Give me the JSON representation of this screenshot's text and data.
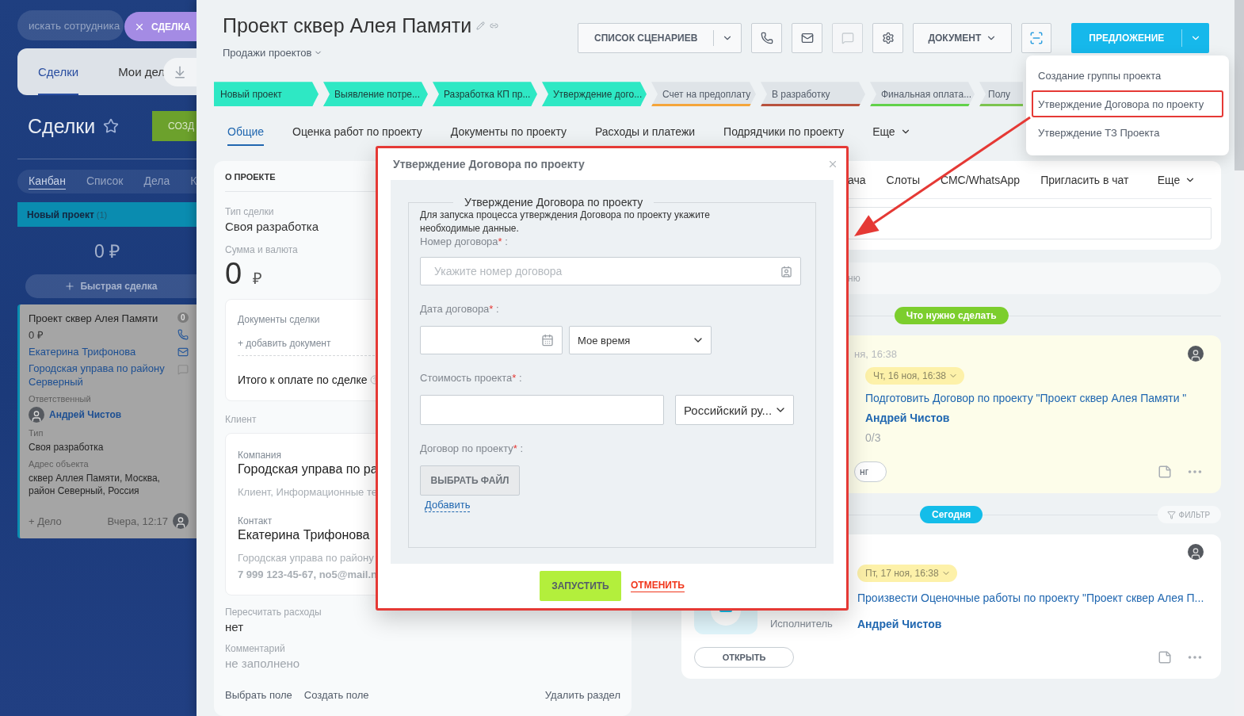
{
  "kanban": {
    "search": {
      "placeholder": "искать сотрудника"
    },
    "deal_chip": "СДЕЛКА",
    "top_tabs": [
      {
        "label": "Сделки",
        "selected": true
      },
      {
        "label": "Мои дел",
        "selected": false
      }
    ],
    "title": "Сделки",
    "create_button": "СОЗД",
    "view_tabs": [
      {
        "label": "Канбан",
        "selected": true
      },
      {
        "label": "Список",
        "selected": false
      },
      {
        "label": "Дела",
        "selected": false
      },
      {
        "label": "К",
        "selected": false
      }
    ],
    "column": {
      "title": "Новый проект",
      "count": "(1)",
      "total": "0 ₽",
      "quick_add": "Быстрая сделка"
    },
    "card": {
      "title": "Проект сквер Алея Памяти",
      "badge": "0",
      "amount": "0 ₽",
      "contact": "Екатерина Трифонова",
      "company": "Городская управа по району Серверный",
      "responsible_label": "Ответственный",
      "responsible": "Андрей Чистов",
      "fields": [
        {
          "label": "Тип",
          "value": "Своя разработка"
        },
        {
          "label": "Адрес объекта",
          "value": "сквер Аллея Памяти, Москва, район Северный, Россия"
        }
      ],
      "add_task": "+ Дело",
      "time": "Вчера, 12:17"
    }
  },
  "deal": {
    "title": "Проект сквер Алея Памяти",
    "pipeline": "Продажи проектов",
    "toolbar": {
      "scenarios": "СПИСОК СЦЕНАРИЕВ",
      "icon_buttons": [
        {
          "kind": "phone",
          "disabled": false
        },
        {
          "kind": "mail",
          "disabled": false
        },
        {
          "kind": "chat",
          "disabled": true
        },
        {
          "kind": "settings",
          "disabled": false
        }
      ],
      "document": "ДОКУМЕНТ",
      "offer": "ПРЕДЛОЖЕНИЕ"
    },
    "stages": [
      {
        "label": "Новый проект",
        "done": true,
        "color": "#2ee8c4"
      },
      {
        "label": "Выявление потре...",
        "done": true,
        "color": "#2ee8c4"
      },
      {
        "label": "Разработка КП пр...",
        "done": true,
        "color": "#2ee8c4"
      },
      {
        "label": "Утверждение дого...",
        "done": true,
        "color": "#2ee8c4"
      },
      {
        "label": "Счет на предоплату",
        "done": false,
        "color": "#f5a53a"
      },
      {
        "label": "В разработку",
        "done": false,
        "color": "#b8523e"
      },
      {
        "label": "Финальная оплата...",
        "done": false,
        "color": "#62d14a"
      },
      {
        "label": "Полу",
        "done": false,
        "color": "#7cc44f"
      }
    ],
    "tabs": [
      {
        "label": "Общие",
        "selected": true
      },
      {
        "label": "Оценка работ по проекту",
        "selected": false
      },
      {
        "label": "Документы по проекту",
        "selected": false
      },
      {
        "label": "Расходы и платежи",
        "selected": false
      },
      {
        "label": "Подрядчики по проекту",
        "selected": false
      }
    ],
    "more_tab": "Еще",
    "about": {
      "heading": "О ПРОЕКТЕ",
      "type_label": "Тип сделки",
      "type": "Своя разработка",
      "amount_label": "Сумма и валюта",
      "amount": "0",
      "currency": "₽",
      "documents": {
        "title": "Документы сделки",
        "add": "+ добавить документ",
        "total": "Итого к оплате по сделке"
      },
      "client_label": "Клиент",
      "client": {
        "company_label": "Компания",
        "company": "Городская управа по ра",
        "company_meta": "Клиент, Информационные те",
        "contact_label": "Контакт",
        "contact": "Екатерина Трифонова",
        "contact_company": "Городская управа по району",
        "contact_details": "7 999 123-45-67, no5@mail.n"
      },
      "extra_fields": [
        {
          "label": "Пересчитать расходы",
          "value": "нет",
          "empty": false
        },
        {
          "label": "Комментарий",
          "value": "не заполнено",
          "empty": true
        }
      ],
      "footer_links": [
        "Выбрать поле",
        "Создать поле"
      ],
      "delete_link": "Удалить раздел"
    },
    "activity": {
      "tabs": [
        "ача",
        "Слоты",
        "СМС/WhatsApp",
        "Пригласить в чат"
      ],
      "more": "Еще",
      "comment_hint": "ню",
      "sections": [
        {
          "kind": "todo",
          "label": "Что нужно сделать",
          "tasks": [
            {
              "kind": "todo",
              "created": "ня, 16:38",
              "deadline": "Чт, 16 ноя, 16:38",
              "title": "Подготовить Договор по проекту \"Проект сквер Алея Памяти \"",
              "assignee": "Андрей Чистов",
              "progress": "0/3",
              "action": "нг"
            }
          ]
        },
        {
          "kind": "today",
          "label": "Сегодня",
          "filter": "ФИЛЬТР",
          "tasks": [
            {
              "kind": "workflow",
              "deadline": "Пт, 17 ноя, 16:38",
              "title": "Произвести Оценочные работы по проекту \"Проект сквер Алея П...",
              "assignee_label": "Исполнитель",
              "assignee": "Андрей Чистов",
              "action": "ОТКРЫТЬ"
            }
          ]
        }
      ]
    }
  },
  "dropdown": {
    "items": [
      {
        "label": "Создание группы проекта",
        "highlighted": false
      },
      {
        "label": "Утверждение Договора по проекту",
        "highlighted": true
      },
      {
        "label": "Утверждение ТЗ Проекта",
        "highlighted": false
      }
    ]
  },
  "modal": {
    "title": "Утверждение Договора по проекту",
    "highlighted": true,
    "legend": "Утверждение Договора по проекту",
    "description": "Для запуска процесса утверждения Договора по проекту укажите необходимые данные.",
    "fields": [
      {
        "kind": "text",
        "label": "Номер договора",
        "mark": "*",
        "tail": " :",
        "placeholder": "Укажите номер договора"
      },
      {
        "kind": "date",
        "label": "Дата договора",
        "mark": "*",
        "tail": " :",
        "select": "Мое время"
      },
      {
        "kind": "money",
        "label": "Стоимость проекта",
        "mark": "*",
        "tail": " :",
        "select": "Российский ру..."
      },
      {
        "kind": "file",
        "label": "Договор по проекту",
        "mark": "*",
        "tail": " :",
        "button": "ВЫБРАТЬ ФАЙЛ",
        "link": "Добавить"
      }
    ],
    "submit": "ЗАПУСТИТЬ",
    "cancel": "ОТМЕНИТЬ"
  }
}
